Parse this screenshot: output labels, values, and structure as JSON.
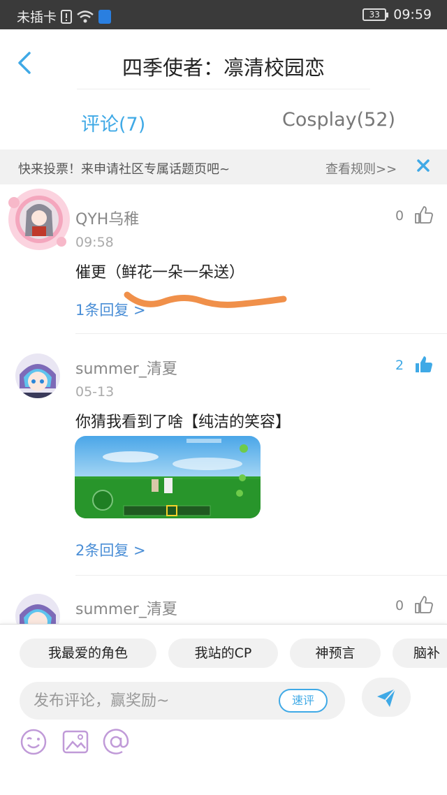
{
  "status_bar": {
    "carrier": "未插卡",
    "battery": "33",
    "time": "09:59"
  },
  "header": {
    "title": "四季使者：凛清校园恋"
  },
  "tabs": [
    {
      "label": "评论(7)"
    },
    {
      "label": "Cosplay(52)"
    }
  ],
  "notice": {
    "text": "快来投票！来申请社区专属话题页吧~",
    "rule_link": "查看规则>>"
  },
  "comments": [
    {
      "username": "QYH乌稚",
      "time": "09:58",
      "text": "催更（鲜花一朵一朵送）",
      "replies": "1条回复 >",
      "likes": "0"
    },
    {
      "username": "summer_清夏",
      "time": "05-13",
      "text": "你猜我看到了啥【纯洁的笑容】",
      "replies": "2条回复 >",
      "likes": "2"
    },
    {
      "username": "summer_清夏",
      "likes": "0"
    }
  ],
  "chips": [
    "我最爱的角色",
    "我站的CP",
    "神预言",
    "脑补"
  ],
  "composer": {
    "placeholder": "发布评论，赢奖励~",
    "quick_label": "速评"
  },
  "colors": {
    "accent": "#3fa9e6",
    "reply_link": "#4a8ed6",
    "scribble": "#f0904a"
  }
}
